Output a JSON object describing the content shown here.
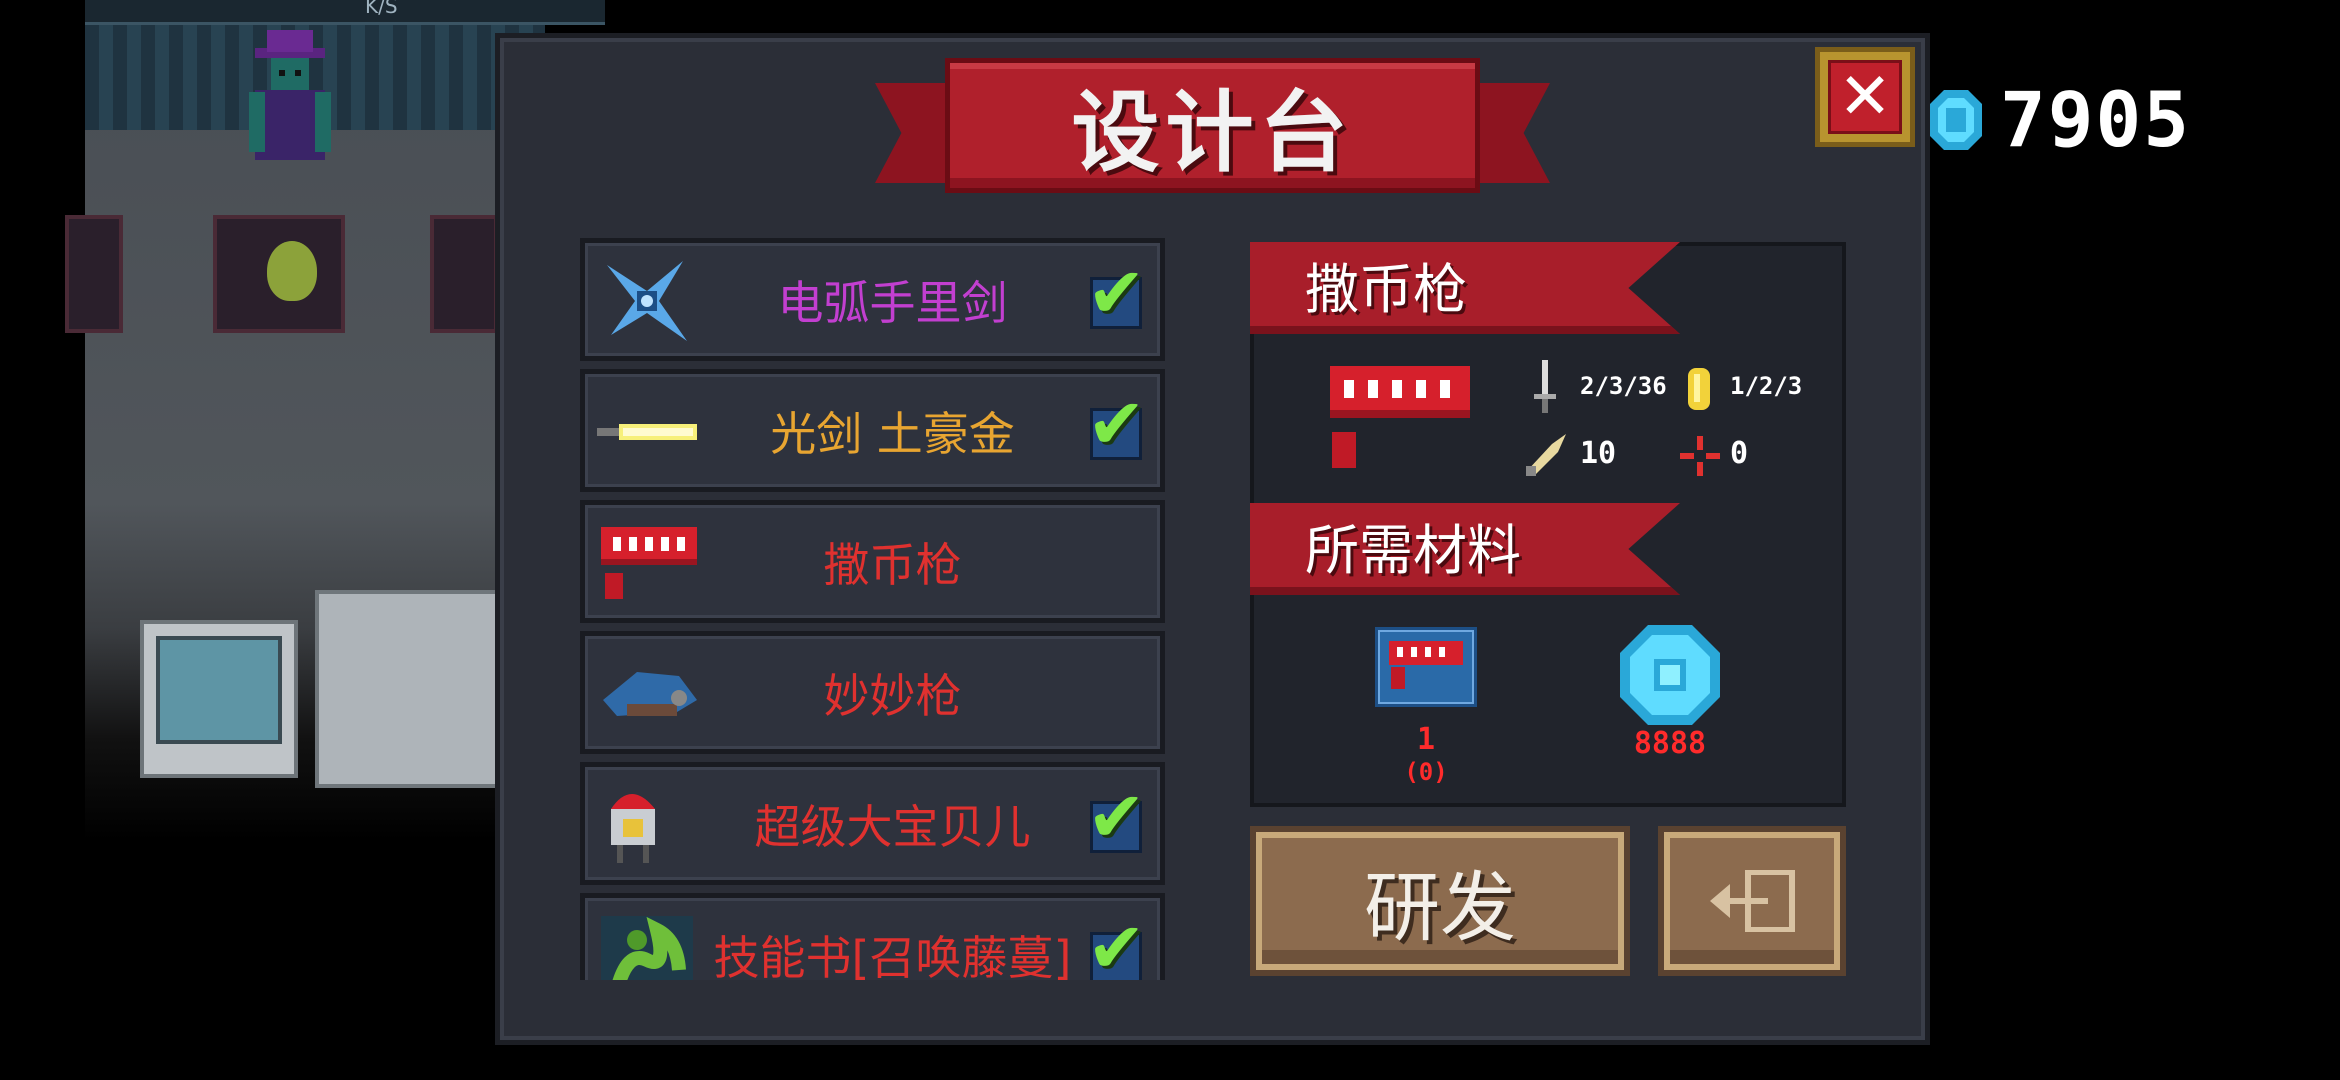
{
  "scene": {
    "status_text": "K/S"
  },
  "currency": {
    "gem_count": "7905",
    "icon": "blue-gem-icon",
    "color": "#3ec8f0"
  },
  "dialog": {
    "title": "设计台",
    "close_icon": "close-icon"
  },
  "weapon_list": [
    {
      "name": "电弧手里剑",
      "icon": "shuriken-icon",
      "color": "#c23fd0",
      "owned": true
    },
    {
      "name": "光剑 土豪金",
      "icon": "lightsaber-gold-icon",
      "color": "#e8a531",
      "owned": true
    },
    {
      "name": "撒币枪",
      "icon": "coin-gun-icon",
      "color": "#e0312f",
      "owned": false
    },
    {
      "name": "妙妙枪",
      "icon": "blue-gun-icon",
      "color": "#e0312f",
      "owned": false
    },
    {
      "name": "超级大宝贝儿",
      "icon": "baby-bomb-icon",
      "color": "#e0312f",
      "owned": true
    },
    {
      "name": "技能书[召唤藤蔓]",
      "icon": "vine-book-icon",
      "color": "#e0312f",
      "owned": true
    }
  ],
  "selected": {
    "name": "撒币枪",
    "icon": "coin-gun-icon",
    "stats": {
      "damage": "2/3/36",
      "energy": "1/2/3",
      "crit": "10",
      "spread": "0"
    }
  },
  "materials": {
    "heading": "所需材料",
    "items": [
      {
        "icon": "coin-gun-blueprint-icon",
        "amount": "1",
        "owned": "(0)"
      },
      {
        "icon": "blue-gem-icon",
        "amount": "8888"
      }
    ]
  },
  "buttons": {
    "research": "研发",
    "exit_icon": "exit-icon"
  }
}
